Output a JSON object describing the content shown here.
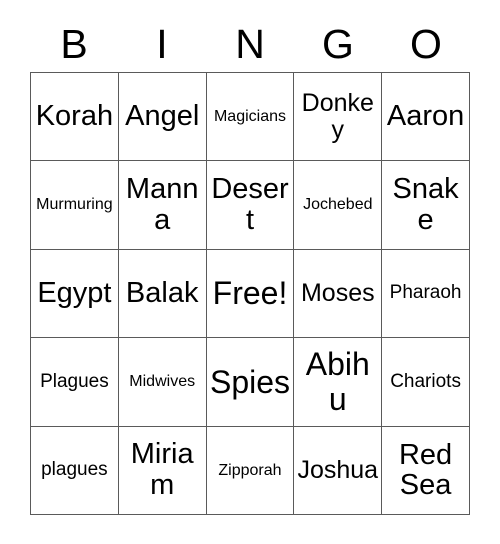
{
  "card": {
    "type": "bingo-card",
    "header_letters": [
      "B",
      "I",
      "N",
      "G",
      "O"
    ],
    "columns": 5,
    "rows": 5,
    "colors": {
      "background": "#ffffff",
      "text": "#000000",
      "grid_line": "#5a5a5a"
    },
    "free_space": {
      "row": 2,
      "column": 2,
      "label": "Free!"
    },
    "grid": [
      [
        {
          "label": "Korah",
          "size": "lg"
        },
        {
          "label": "Angel",
          "size": "lg"
        },
        {
          "label": "Magicians",
          "size": "xs"
        },
        {
          "label": "Donkey",
          "size": "md"
        },
        {
          "label": "Aaron",
          "size": "lg"
        }
      ],
      [
        {
          "label": "Murmuring",
          "size": "xs"
        },
        {
          "label": "Manna",
          "size": "lg"
        },
        {
          "label": "Desert",
          "size": "lg"
        },
        {
          "label": "Jochebed",
          "size": "xs"
        },
        {
          "label": "Snake",
          "size": "lg"
        }
      ],
      [
        {
          "label": "Egypt",
          "size": "lg"
        },
        {
          "label": "Balak",
          "size": "lg"
        },
        {
          "label": "Free!",
          "size": "xl"
        },
        {
          "label": "Moses",
          "size": "md"
        },
        {
          "label": "Pharaoh",
          "size": "sm"
        }
      ],
      [
        {
          "label": "Plagues",
          "size": "sm"
        },
        {
          "label": "Midwives",
          "size": "xs"
        },
        {
          "label": "Spies",
          "size": "xl"
        },
        {
          "label": "Abihu",
          "size": "xl"
        },
        {
          "label": "Chariots",
          "size": "sm"
        }
      ],
      [
        {
          "label": "plagues",
          "size": "sm"
        },
        {
          "label": "Miriam",
          "size": "lg"
        },
        {
          "label": "Zipporah",
          "size": "xs"
        },
        {
          "label": "Joshua",
          "size": "md"
        },
        {
          "label": "Red Sea",
          "size": "wrap2"
        }
      ]
    ]
  }
}
